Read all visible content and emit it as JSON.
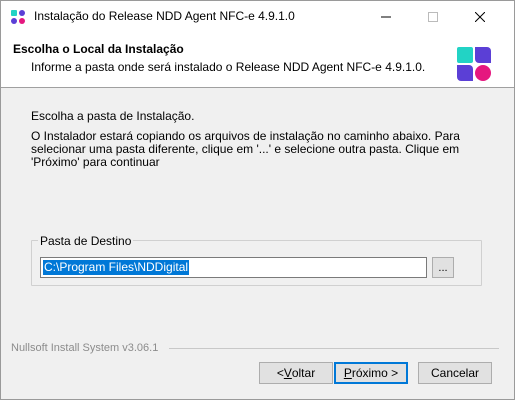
{
  "window": {
    "title": "Instalação do Release NDD Agent NFC-e 4.9.1.0"
  },
  "header": {
    "title": "Escolha o Local da Instalação",
    "subtitle": "Informe a pasta onde será instalado o Release NDD Agent NFC-e 4.9.1.0."
  },
  "body": {
    "intro": "Escolha a pasta de Instalação.",
    "description": "O Instalador estará copiando os arquivos de instalação no caminho abaixo. Para selecionar uma pasta diferente, clique em '...' e selecione outra pasta. Clique em 'Próximo' para continuar"
  },
  "destination": {
    "group_label": "Pasta de Destino",
    "path_value": "C:\\Program Files\\NDDigital",
    "browse_label": "..."
  },
  "footer": {
    "branding": "Nullsoft Install System v3.06.1"
  },
  "buttons": {
    "back_prefix": "< ",
    "back_accel": "V",
    "back_rest": "oltar",
    "next_accel": "P",
    "next_rest": "róximo >",
    "cancel": "Cancelar"
  },
  "colors": {
    "logo_teal": "#22d3c5",
    "logo_purple": "#5b3fd6",
    "logo_pink": "#e5177f",
    "selection": "#0078d7"
  }
}
